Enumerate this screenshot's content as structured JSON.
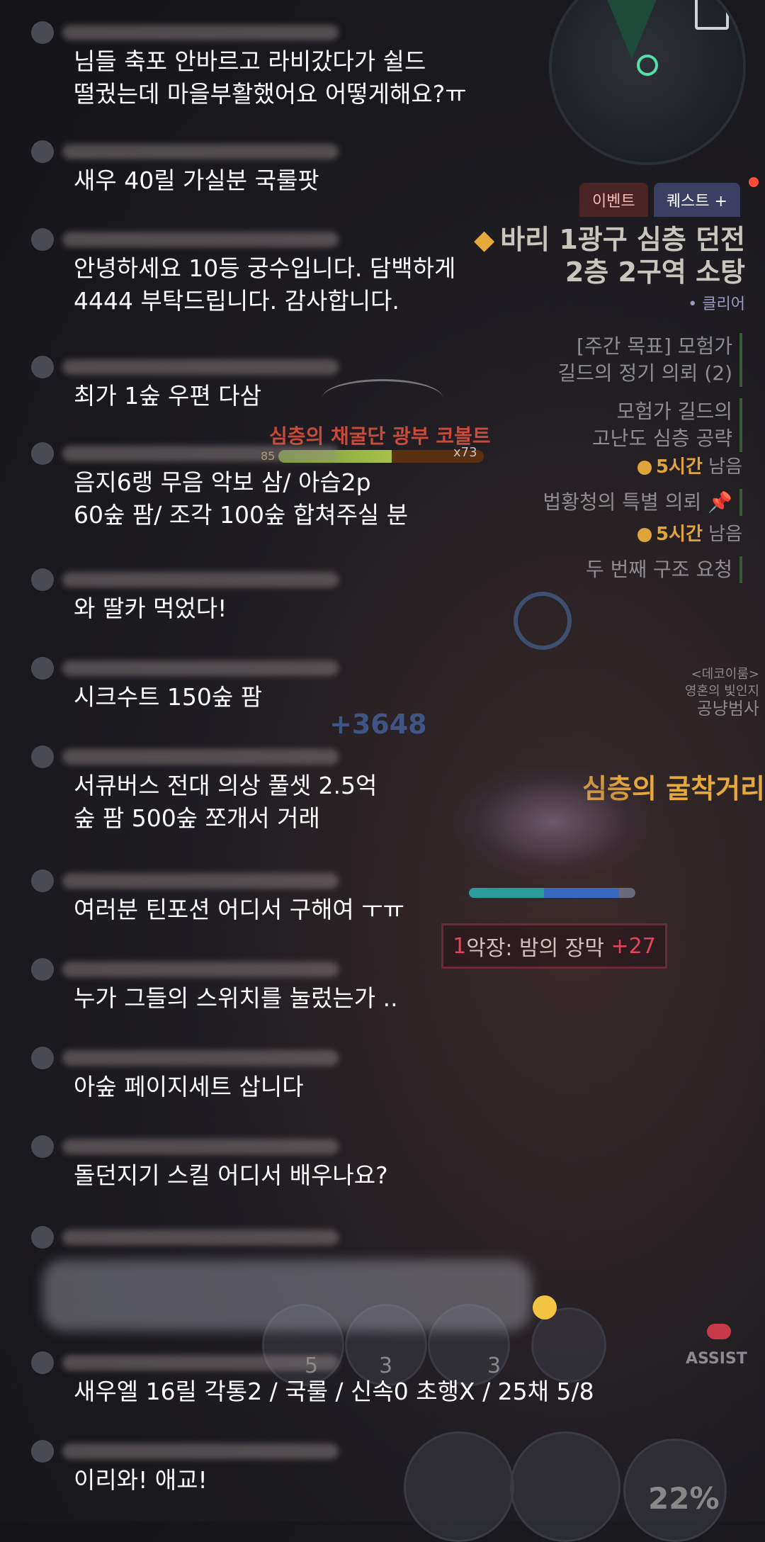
{
  "quest_panel": {
    "tabs": [
      {
        "label": "이벤트",
        "active": false
      },
      {
        "label": "퀘스트 +",
        "active": true
      }
    ],
    "main_quest": {
      "title_line1": "바리 1광구 심층 던전",
      "title_line2": "2층 2구역 소탕",
      "status": "• 클리어"
    },
    "quests": [
      {
        "line1": "[주간 목표] 모험가",
        "line2": "길드의 정기 의뢰 (2)"
      },
      {
        "line1": "모험가 길드의",
        "line2": "고난도 심층 공략",
        "time": "5시간",
        "time_suffix": " 남음"
      },
      {
        "line1": "법황청의 특별 의뢰",
        "time": "5시간",
        "time_suffix": " 남음"
      },
      {
        "line1": "두 번째 구조 요청"
      }
    ]
  },
  "boss": {
    "name": "심층의 채굴단 광부 코볼트",
    "level": "85",
    "multiplier": "x73",
    "hp_percent": 55
  },
  "scene": {
    "location": "심층의 굴착거리",
    "npc_line1": "<데코이룸>",
    "npc_line2": "영혼의 빛인지",
    "npc_line3": "공냥범사",
    "damage": "+3648",
    "act_prefix": "1",
    "act_text": "악장: 밤의 장막",
    "act_bonus": "+27",
    "skill_counts": [
      "5",
      "3",
      "3"
    ],
    "assist_label": "ASSIST",
    "percent": "22%"
  },
  "chat": [
    {
      "text": "님들 축포 안바르고 라비갔다가 쉴드\n떨궜는데 마을부활했어요 어떻게해요?ㅠ"
    },
    {
      "text": "새우 40릴 가실분 국룰팟"
    },
    {
      "text": "안녕하세요 10등 궁수입니다. 담백하게\n4444 부탁드립니다. 감사합니다."
    },
    {
      "text": "최가 1숲 우편 다삼"
    },
    {
      "text": "음지6랭 무음 악보 삼/ 아습2p\n60숲 팜/ 조각 100숲 합쳐주실 분"
    },
    {
      "text": "와 딸카 먹었다!"
    },
    {
      "text": "시크수트 150숲 팜"
    },
    {
      "text": "서큐버스 전대 의상 풀셋 2.5억\n숲 팜 500숲 쪼개서 거래"
    },
    {
      "text": "여러분 틴포션 어디서 구해여 ㅜㅠ"
    },
    {
      "text": "누가 그들의 스위치를 눌렀는가 .."
    },
    {
      "text": "아숲 페이지세트 삽니다"
    },
    {
      "text": "돌던지기 스킬 어디서 배우나요?"
    },
    {
      "text": "새우엘 16릴 각통2 / 국룰 / 신속0 초행X / 25채 5/8"
    },
    {
      "text": "이리와! 애교!"
    }
  ]
}
